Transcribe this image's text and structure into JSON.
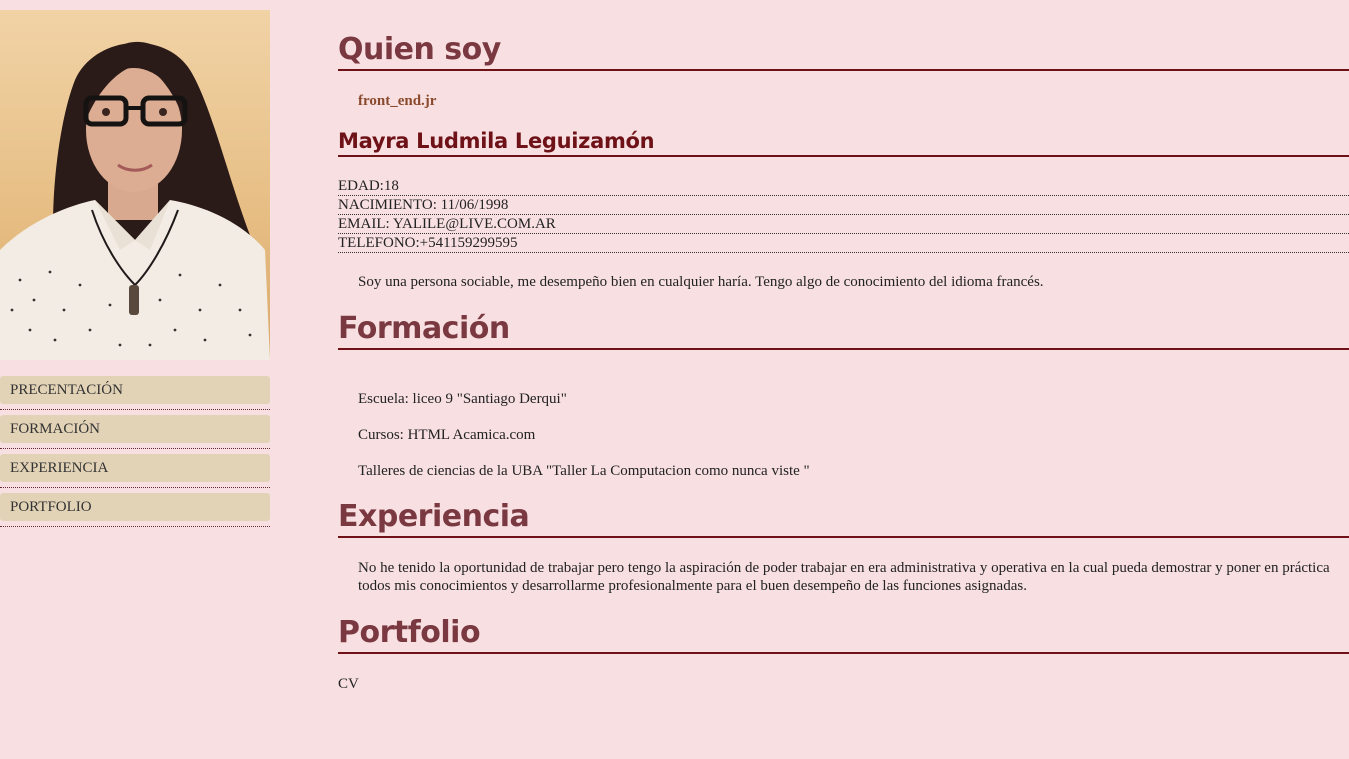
{
  "sidebar": {
    "nav": [
      "PRECENTACIÓN",
      "FORMACIÓN",
      "EXPERIENCIA",
      "PORTFOLIO"
    ]
  },
  "about": {
    "heading": "Quien soy",
    "role": "front_end.jr",
    "name": "Mayra Ludmila Leguizamón",
    "facts": [
      "EDAD:18",
      "NACIMIENTO: 11/06/1998",
      "EMAIL: YALILE@LIVE.COM.AR",
      "TELEFONO:+541159299595"
    ],
    "description": "Soy una persona sociable, me desempeño bien en cualquier haría. Tengo algo de conocimiento del idioma francés."
  },
  "education": {
    "heading": "Formación",
    "items": [
      "Escuela: liceo 9 \"Santiago Derqui\"",
      "Cursos: HTML Acamica.com",
      "Talleres de ciencias de la UBA \"Taller La Computacion como nunca viste \""
    ]
  },
  "experience": {
    "heading": "Experiencia",
    "text": "No he tenido la oportunidad de trabajar pero tengo la aspiración de poder trabajar en era administrativa y operativa en la cual pueda demostrar y poner en práctica todos mis conocimientos y desarrollarme profesionalmente para el buen desempeño de las funciones asignadas."
  },
  "portfolio": {
    "heading": "Portfolio",
    "link": "CV"
  },
  "colors": {
    "background": "#f8e0e2",
    "heading": "#7a3941",
    "rule": "#6e1218",
    "nav_bg": "#e2d3b7"
  }
}
